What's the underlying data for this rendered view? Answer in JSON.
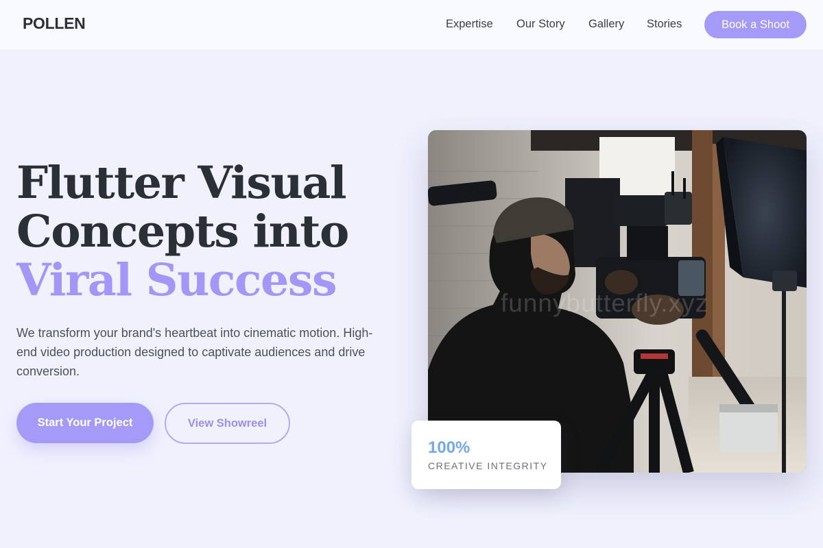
{
  "header": {
    "logo": "POLLEN",
    "nav": [
      {
        "label": "Expertise"
      },
      {
        "label": "Our Story"
      },
      {
        "label": "Gallery"
      },
      {
        "label": "Stories"
      }
    ],
    "cta_label": "Book a Shoot"
  },
  "hero": {
    "headline_line1": "Flutter Visual",
    "headline_line2": "Concepts into",
    "headline_accent": "Viral Success",
    "subtext": "We transform your brand's heartbeat into cinematic motion. High-end video production designed to captivate audiences and drive conversion.",
    "primary_button": "Start Your Project",
    "secondary_button": "View Showreel",
    "image_watermark": "funnybutterfly.xyz"
  },
  "stat_card": {
    "value": "100%",
    "label": "CREATIVE INTEGRITY"
  },
  "colors": {
    "accent": "#a49af7",
    "background": "#f0f1fd",
    "stat_value": "#74a8ea",
    "text_dark": "#2b3036"
  }
}
